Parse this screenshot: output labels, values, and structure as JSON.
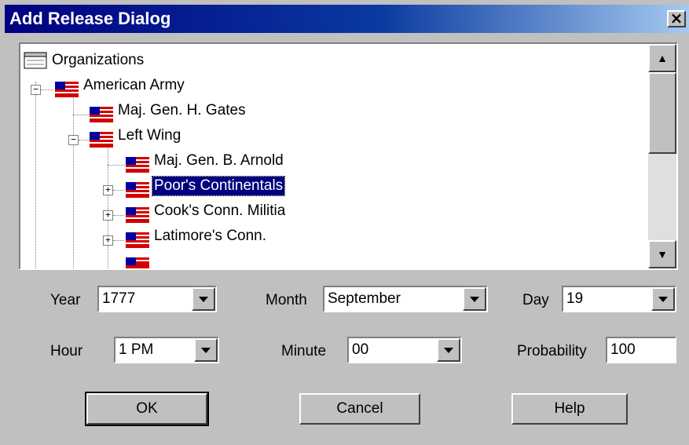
{
  "window": {
    "title": "Add Release Dialog",
    "close_glyph": "×"
  },
  "tree": {
    "nodes": [
      {
        "label": "Organizations",
        "icon": "org-icon"
      },
      {
        "label": "American Army",
        "icon": "flag-icon",
        "expander": "−"
      },
      {
        "label": "Maj. Gen. H. Gates",
        "icon": "flag-icon"
      },
      {
        "label": "Left Wing",
        "icon": "flag-icon",
        "expander": "−"
      },
      {
        "label": "Maj. Gen. B. Arnold",
        "icon": "flag-icon"
      },
      {
        "label": "Poor's Continentals",
        "icon": "flag-icon",
        "expander": "+",
        "selected": true
      },
      {
        "label": "Cook's Conn. Militia",
        "icon": "flag-icon",
        "expander": "+"
      },
      {
        "label": "Latimore's Conn.",
        "icon": "flag-icon",
        "expander": "+"
      }
    ],
    "scroll_up": "▲",
    "scroll_down": "▼"
  },
  "fields": {
    "year": {
      "label": "Year",
      "value": "1777"
    },
    "month": {
      "label": "Month",
      "value": "September"
    },
    "day": {
      "label": "Day",
      "value": "19"
    },
    "hour": {
      "label": "Hour",
      "value": "1 PM"
    },
    "minute": {
      "label": "Minute",
      "value": "00"
    },
    "probability": {
      "label": "Probability",
      "value": "100"
    }
  },
  "buttons": {
    "ok": "OK",
    "cancel": "Cancel",
    "help": "Help"
  },
  "colors": {
    "titlebar": "#000080",
    "selection": "#000080",
    "flag_red": "#d40000",
    "flag_blue": "#0000a0"
  }
}
